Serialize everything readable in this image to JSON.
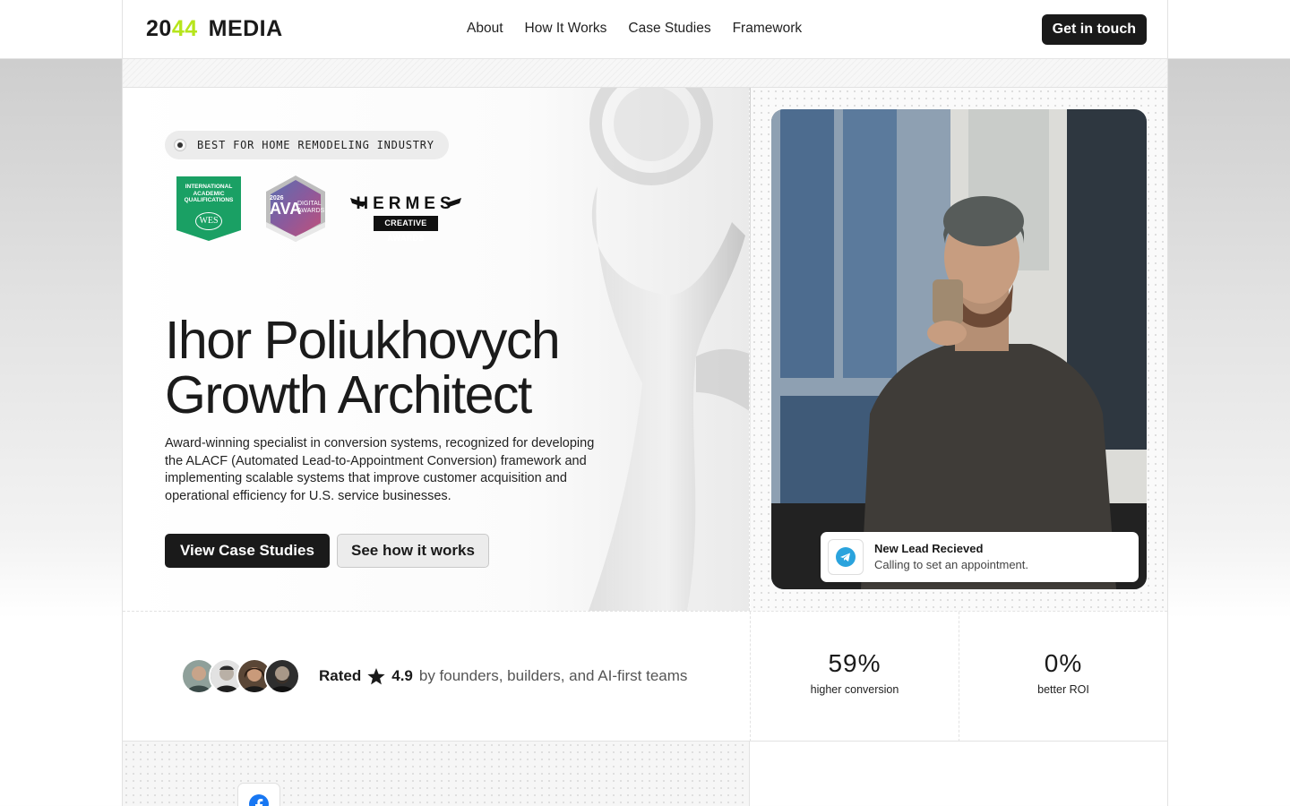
{
  "header": {
    "logo_num_a": "20",
    "logo_num_b": "44",
    "logo_word": "MEDIA",
    "nav": [
      "About",
      "How It Works",
      "Case Studies",
      "Framework"
    ],
    "cta": "Get in touch"
  },
  "hero": {
    "pill": "BEST FOR HOME REMODELING INDUSTRY",
    "badges": {
      "wes_label": "INTERNATIONAL ACADEMIC QUALIFICATIONS",
      "wes_mark": "WES",
      "ava_year": "2026",
      "ava_name": "AVA",
      "ava_sub": "DIGITAL AWARDS",
      "hermes_name": "HERMES",
      "hermes_sub": "CREATIVE AWARDS"
    },
    "title_line1": "Ihor Poliukhovych",
    "title_line2": "Growth Architect",
    "description": "Award-winning specialist in conversion systems, recognized for developing the ALACF (Automated Lead-to-Appointment Conversion) framework and implementing scalable systems that improve customer acquisition and operational efficiency for U.S. service businesses.",
    "primary_button": "View Case Studies",
    "secondary_button": "See how it works"
  },
  "notification": {
    "icon": "telegram-icon",
    "title": "New Lead Recieved",
    "subtitle": "Calling to set an appointment."
  },
  "rating": {
    "prefix": "Rated",
    "score": "4.9",
    "suffix": "by founders, builders, and AI-first teams"
  },
  "stats": [
    {
      "value": "59%",
      "label": "higher conversion"
    },
    {
      "value": "0%",
      "label": "better ROI"
    }
  ],
  "colors": {
    "accent": "#b6e51c",
    "dark": "#1a1a1a",
    "wes_green": "#1aa064",
    "telegram_blue": "#2aa3dd",
    "facebook_blue": "#1877f2"
  },
  "icons": [
    "star-icon",
    "telegram-icon",
    "facebook-icon"
  ]
}
